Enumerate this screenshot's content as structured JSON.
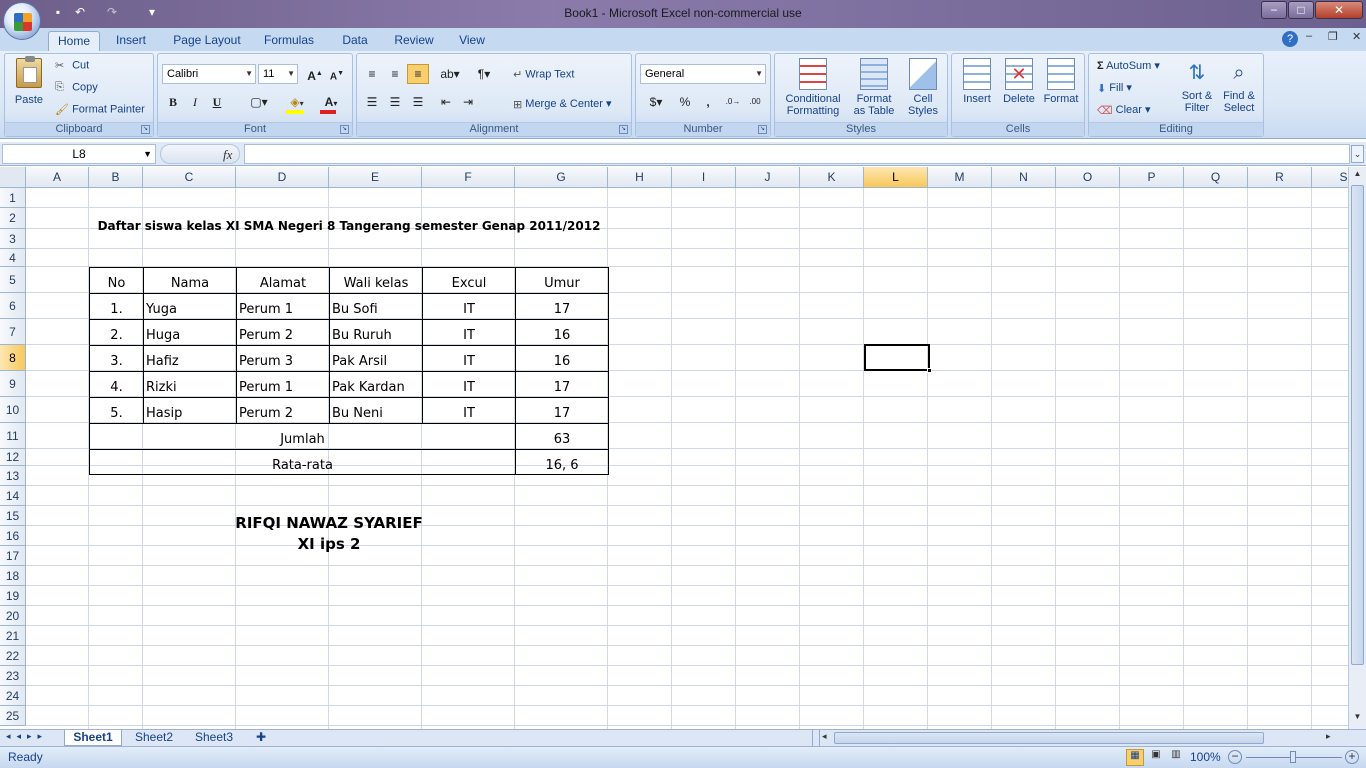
{
  "window": {
    "title": "Book1 - Microsoft Excel non-commercial use",
    "controls": {
      "minimize": "−",
      "maximize": "□",
      "close": "✕"
    }
  },
  "quick_access": {
    "save": "💾",
    "undo": "↶",
    "redo": "↷",
    "customize": "▾"
  },
  "tabs": [
    "Home",
    "Insert",
    "Page Layout",
    "Formulas",
    "Data",
    "Review",
    "View"
  ],
  "active_tab": "Home",
  "ribbon": {
    "clipboard": {
      "label": "Clipboard",
      "paste": "Paste",
      "cut": "Cut",
      "copy": "Copy",
      "format_painter": "Format Painter"
    },
    "font": {
      "label": "Font",
      "family": "Calibri",
      "size": "11",
      "bold": "B",
      "italic": "I",
      "underline": "U"
    },
    "alignment": {
      "label": "Alignment",
      "wrap_text": "Wrap Text",
      "merge_center": "Merge & Center"
    },
    "number": {
      "label": "Number",
      "format": "General",
      "percent": "%",
      "comma": ","
    },
    "styles": {
      "label": "Styles",
      "conditional": [
        "Conditional",
        "Formatting"
      ],
      "format_table": [
        "Format",
        "as Table"
      ],
      "cell_styles": [
        "Cell",
        "Styles"
      ]
    },
    "cells": {
      "label": "Cells",
      "insert": "Insert",
      "delete": "Delete",
      "format": "Format"
    },
    "editing": {
      "label": "Editing",
      "autosum": "AutoSum",
      "fill": "Fill",
      "clear": "Clear",
      "sort_filter": [
        "Sort &",
        "Filter"
      ],
      "find_select": [
        "Find &",
        "Select"
      ]
    }
  },
  "formula_bar": {
    "name_box": "L8",
    "fx": "fx",
    "value": ""
  },
  "columns": [
    "A",
    "B",
    "C",
    "D",
    "E",
    "F",
    "G",
    "H",
    "I",
    "J",
    "K",
    "L",
    "M",
    "N",
    "O",
    "P",
    "Q",
    "R",
    "S"
  ],
  "selected_column": "L",
  "rows": [
    "1",
    "2",
    "3",
    "4",
    "5",
    "6",
    "7",
    "8",
    "9",
    "10",
    "11",
    "12",
    "13",
    "14",
    "15",
    "16",
    "17",
    "18",
    "19",
    "20",
    "21",
    "22",
    "23",
    "24",
    "25"
  ],
  "selected_row": "8",
  "sheet": {
    "title": "Daftar siswa kelas XI SMA Negeri 8 Tangerang semester Genap 2011/2012",
    "headers": [
      "No",
      "Nama",
      "Alamat",
      "Wali kelas",
      "Excul",
      "Umur"
    ],
    "rows": [
      [
        "1.",
        "Yuga",
        "Perum 1",
        "Bu Sofi",
        "IT",
        "17"
      ],
      [
        "2.",
        "Huga",
        "Perum 2",
        "Bu Ruruh",
        "IT",
        "16"
      ],
      [
        "3.",
        "Hafiz",
        "Perum 3",
        "Pak Arsil",
        "IT",
        "16"
      ],
      [
        "4.",
        "Rizki",
        "Perum 1",
        "Pak Kardan",
        "IT",
        "17"
      ],
      [
        "5.",
        "Hasip",
        "Perum 2",
        "Bu Neni",
        "IT",
        "17"
      ]
    ],
    "jumlah_label": "Jumlah",
    "jumlah_value": "63",
    "rata_label": "Rata-rata",
    "rata_value": "16, 6",
    "author_name": "RIFQI NAWAZ SYARIEF",
    "author_class": "XI ips 2"
  },
  "sheet_tabs": [
    "Sheet1",
    "Sheet2",
    "Sheet3"
  ],
  "active_sheet": "Sheet1",
  "status": {
    "ready": "Ready",
    "zoom": "100%"
  }
}
